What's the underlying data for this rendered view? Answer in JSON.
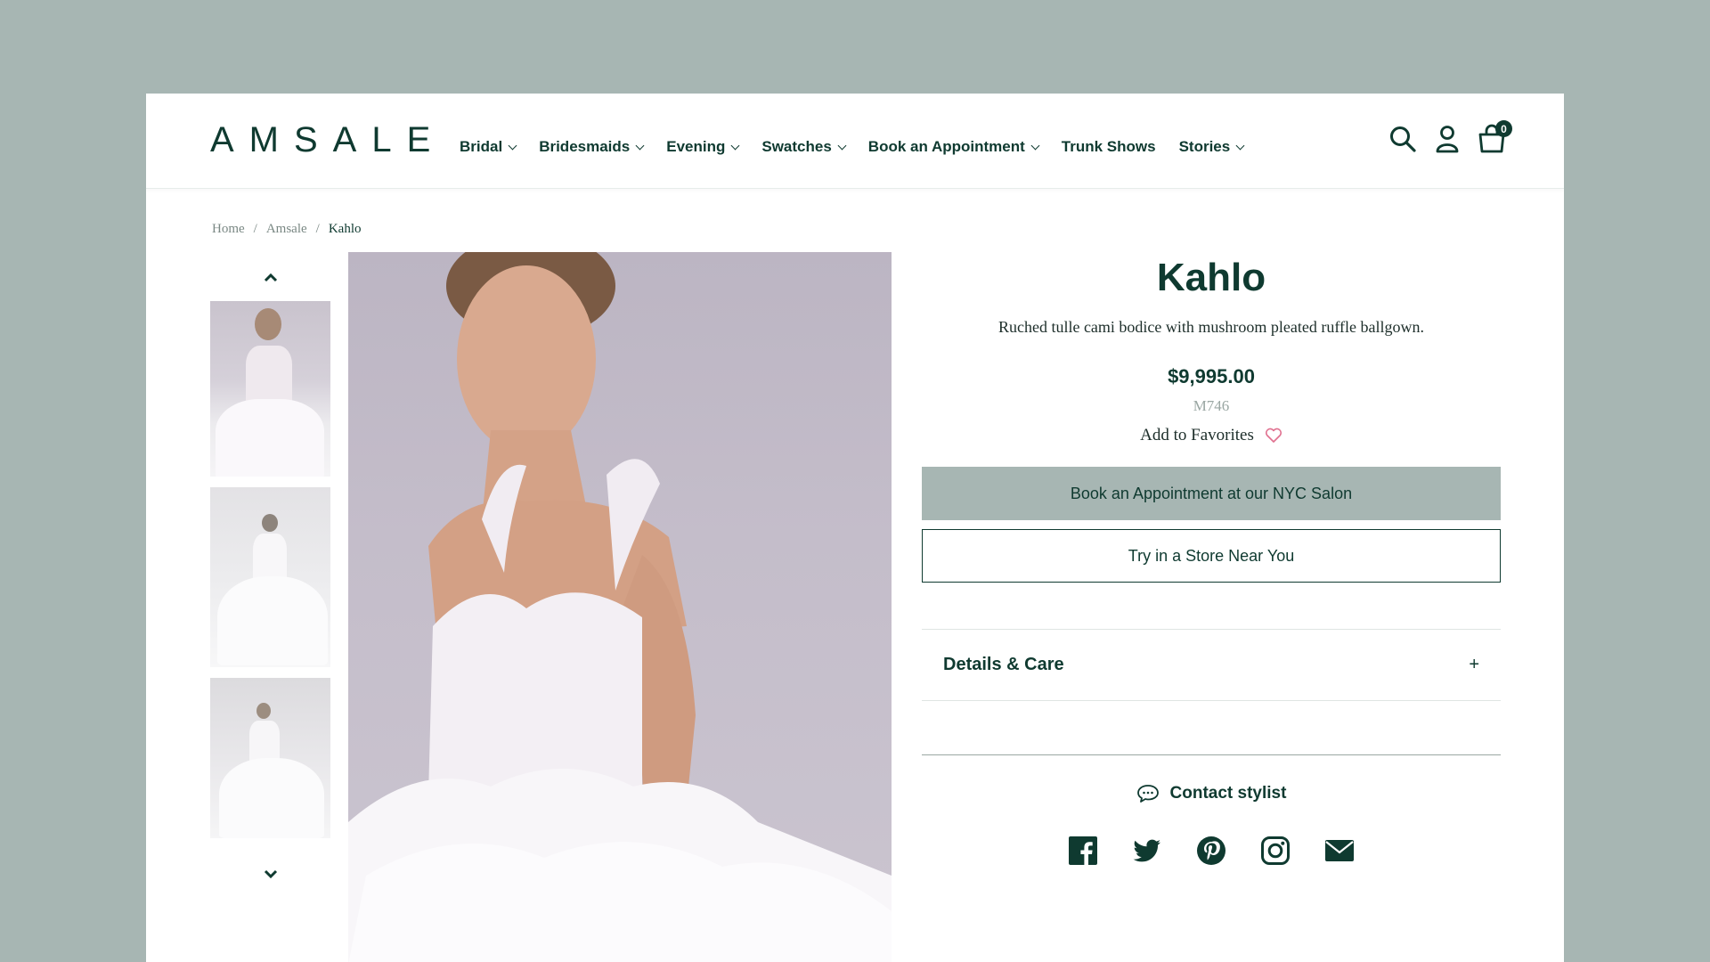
{
  "header": {
    "logo": "AMSALE",
    "nav": [
      {
        "label": "Bridal",
        "dropdown": true
      },
      {
        "label": "Bridesmaids",
        "dropdown": true
      },
      {
        "label": "Evening",
        "dropdown": true
      },
      {
        "label": "Swatches",
        "dropdown": true
      },
      {
        "label": "Book an Appointment",
        "dropdown": true
      },
      {
        "label": "Trunk Shows",
        "dropdown": false
      },
      {
        "label": "Stories",
        "dropdown": true
      }
    ],
    "icons": [
      "search-icon",
      "account-icon",
      "cart-icon"
    ],
    "cart_count": "0"
  },
  "breadcrumb": {
    "items": [
      "Home",
      "Amsale",
      "Kahlo"
    ],
    "separator": "/"
  },
  "gallery": {
    "thumbnails": [
      "front-view",
      "back-view",
      "full-length-view"
    ],
    "selected": 0
  },
  "product": {
    "title": "Kahlo",
    "description": "Ruched tulle cami bodice with mushroom pleated ruffle ballgown.",
    "price": "$9,995.00",
    "sku": "M746",
    "favorites_label": "Add to Favorites",
    "primary_cta": "Book an Appointment at our NYC Salon",
    "secondary_cta": "Try in a Store Near You",
    "accordion_label": "Details & Care",
    "accordion_toggle": "+",
    "contact_label": "Contact stylist",
    "social": [
      "facebook-icon",
      "twitter-icon",
      "pinterest-icon",
      "instagram-icon",
      "email-icon"
    ]
  },
  "colors": {
    "background": "#a7b6b3",
    "brand": "#0f3a30",
    "accent_button": "#a7b6b3",
    "favorite_heart": "#e0708f"
  }
}
